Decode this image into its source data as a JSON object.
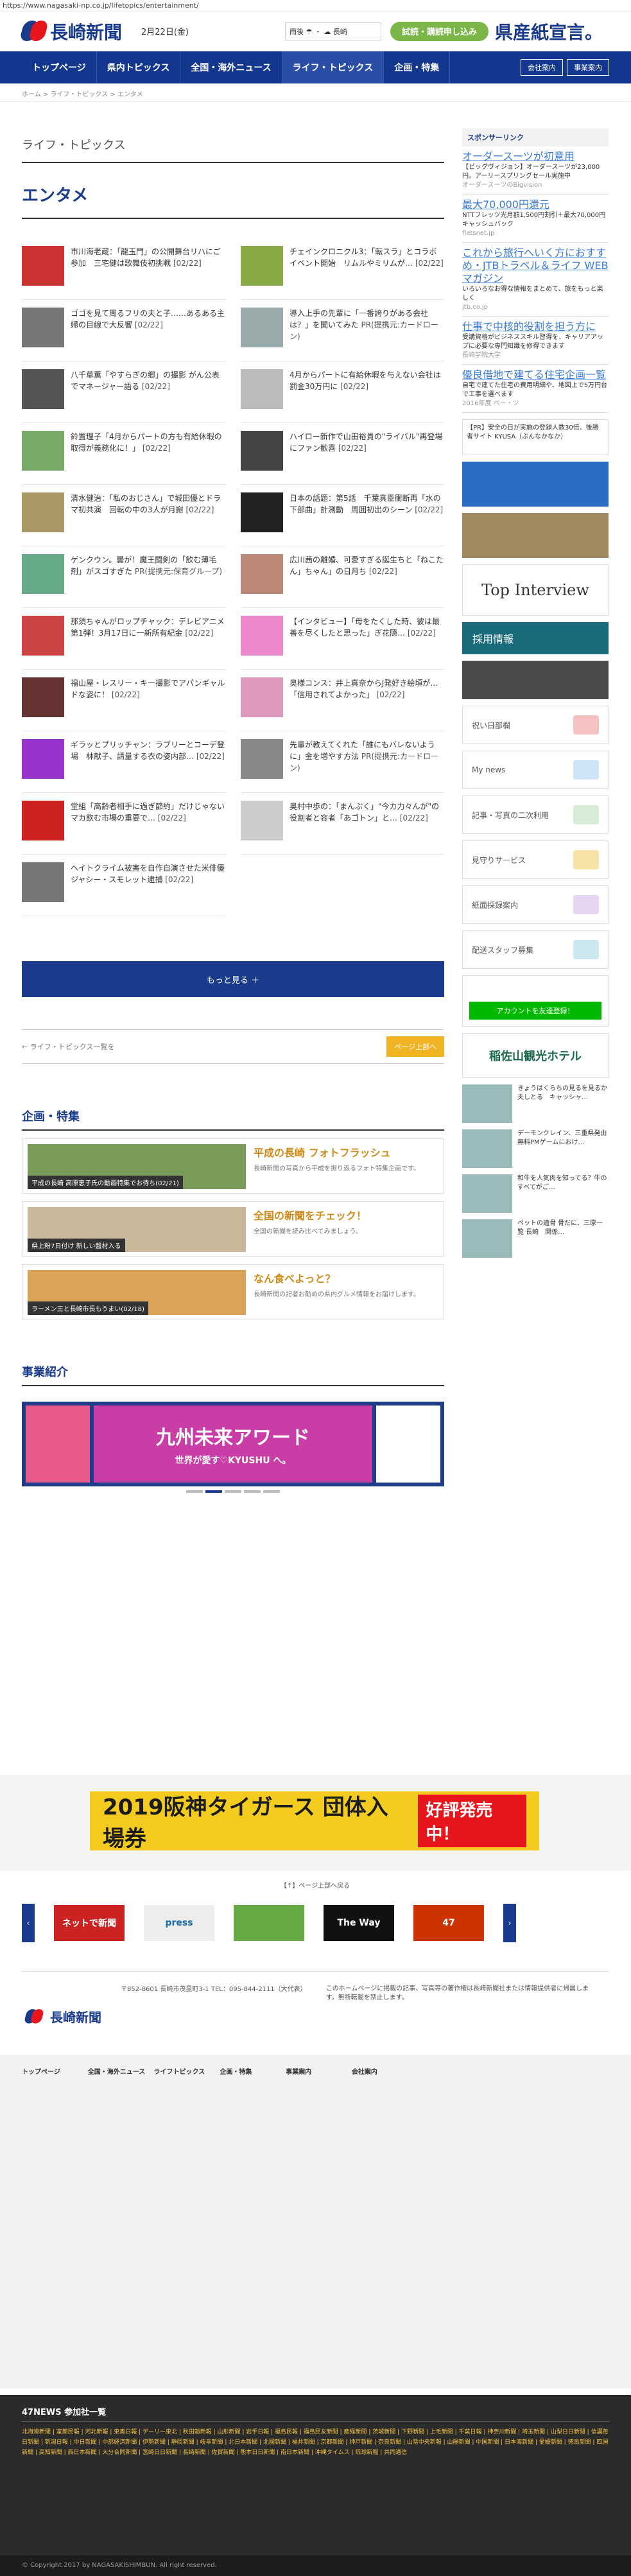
{
  "url": "https://www.nagasaki-np.co.jp/lifetopics/entertainment/",
  "header": {
    "logo": "長崎新聞",
    "date": "2月22日(金)",
    "weather": "雨後 ☂ ・ ☁ 長崎",
    "trial": "試読・購読申し込み",
    "ken": "県産紙宣言。"
  },
  "nav": {
    "items": [
      "トップページ",
      "県内トピックス",
      "全国・海外ニュース",
      "ライフ・トピックス",
      "企画・特集"
    ],
    "company": "会社案内",
    "biz": "事業案内"
  },
  "crumb": "ホーム > ライフ・トピックス > エンタメ",
  "kicker": "ライフ・トピックス",
  "title": "エンタメ",
  "articles": [
    {
      "t": "市川海老蔵：「龍玉門」の公開舞台リハにご参加　三宅健は歌舞伎初挑戦",
      "d": "[02/22]",
      "c": "#c33"
    },
    {
      "t": "チェインクロニクル3：「転スラ」とコラボイベント開始　リムルやミリムが…",
      "d": "[02/22]",
      "c": "#8a4"
    },
    {
      "t": "ゴゴを見て周るフリの夫と子……あるある主婦の目線で大反響",
      "d": "[02/22]",
      "c": "#777"
    },
    {
      "t": "導入上手の先輩に「一番誇りがある会社は？」を聞いてみた",
      "d": "PR(提携元:カードローン)",
      "c": "#9aa"
    },
    {
      "t": "八千草薫「やすらぎの郷」の撮影 がん公表でマネージャー語る",
      "d": "[02/22]",
      "c": "#555"
    },
    {
      "t": "4月からパートに有給休暇を与えない会社は罰金30万円に",
      "d": "[02/22]",
      "c": "#bbb"
    },
    {
      "t": "鈴置理子「4月からパートの方も有給休暇の取得が義務化に！」",
      "d": "[02/22]",
      "c": "#7a6"
    },
    {
      "t": "ハイロー新作で山田裕貴の\"ライバル\"再登場にファン歓喜",
      "d": "[02/22]",
      "c": "#444"
    },
    {
      "t": "清水健治：「私のおじさん」で城田優とドラマ初共演　回転の中の3人が月謝",
      "d": "[02/22]",
      "c": "#a96"
    },
    {
      "t": "日本の話題：第5話　千葉真臣衝断再「水の下部曲」計測動　周囲初出のシーン",
      "d": "[02/22]",
      "c": "#222"
    },
    {
      "t": "ゲンクウン。曇が！魔王闘剣の「飲む薄毛剤」がスゴすぎた",
      "d": "PR(提携元:保育グループ)",
      "c": "#6a8"
    },
    {
      "t": "広川茜の離婚、可愛すぎる誕生ちと「ねこたん」ちゃん」の日月ち",
      "d": "[02/22]",
      "c": "#b87"
    },
    {
      "t": "那須ちゃんがロップチャック：デレビアニメ第1弾！3月17日に一新所有紀金",
      "d": "[02/22]",
      "c": "#c44"
    },
    {
      "t": "【インタビュー】「母をたくした時、彼は最善を尽くしたと思った」ぎ花隠…",
      "d": "[02/22]",
      "c": "#e8c"
    },
    {
      "t": "福山屋・レスリー・キー撮影でアパンギャルドな姿に！",
      "d": "[02/22]",
      "c": "#633"
    },
    {
      "t": "奥様コンス：井上真奈からJ発好き絵頃が…「信用されてよかった」",
      "d": "[02/22]",
      "c": "#d9b"
    },
    {
      "t": "ギラッとプリッチャン：ラブリーとコーデ登場　林献子、請量する衣の姿内部…",
      "d": "[02/22]",
      "c": "#93c"
    },
    {
      "t": "先輩が教えてくれた「誰にもバレないように」金を増やす方法",
      "d": "PR(提携元:カードローン)",
      "c": "#888"
    },
    {
      "t": "堂組「高齢者相手に過ぎ節約」だけじゃない　マカ飲む市場の重要で…",
      "d": "[02/22]",
      "c": "#c22"
    },
    {
      "t": "奥村中歩の：「まんぷく」\"今カ力々んが\"の役割者と容者「あゴトン」と…",
      "d": "[02/22]",
      "c": "#ccc"
    },
    {
      "t": "ヘイトクライム被害を自作自演させた米俳優ジャシー・スモレット逮捕",
      "d": "[02/22]",
      "c": "#777"
    }
  ],
  "more": "もっと見る ＋",
  "pager": {
    "prev": "← ライフ・トピックス一覧を",
    "next": "ページ上部へ"
  },
  "features": {
    "title": "企画・特集",
    "items": [
      {
        "cap": "平成の長崎 高原恵子氏の動画特集でお待ち(02/21)",
        "h": "平成の長崎 フォトフラッシュ",
        "s": "長崎新聞の写真から平成を振り返るフォト特集企画です。"
      },
      {
        "cap": "県上粉7日付け 新しい盤材入る",
        "h": "全国の新聞をチェック！",
        "s": "全国の新聞を読み比べてみましょう。"
      },
      {
        "cap": "ラーメン王と長崎市長もうまい(02/18)",
        "h": "なん食べよっと？",
        "s": "長崎新聞の記者お勧めの県内グルメ情報をお届けします。"
      }
    ]
  },
  "events": {
    "title": "事業紹介",
    "banner": "九州未来アワード",
    "sub": "世界が愛す♡KYUSHU へ。"
  },
  "side": {
    "sponsor": "スポンサーリンク",
    "ads": [
      {
        "t": "オーダースーツが初意用",
        "s": "【ビッグヴィジョン】オーダースーツが23,000円。アーリースプリングセール実施中",
        "src": "オーダースーツのBigvision"
      },
      {
        "t": "最大70,000円還元",
        "s": "NTTフレッツ光月額1,500円割引＋最大70,000円キャッシュバック",
        "src": "fletsnet.jp"
      },
      {
        "t": "これから旅行へいく方におすすめ・JTBトラベル＆ライフ WEBマガジン",
        "s": "いろいろなお得な情報をまとめて、旅をもっと楽しく",
        "src": "jtb.co.jp"
      },
      {
        "t": "仕事で中核的役割を担う方に",
        "s": "受講資格がビジネススキル習得を、キャリアアップに必要な専門知識を修得できます",
        "src": "長崎学院大学"
      },
      {
        "t": "優良借地で建てる住宅企画一覧",
        "s": "自宅で建てた住宅の費用明細や、地図上で5万円台で工事を選べます",
        "src": "2016年度 ペー・ツ"
      }
    ],
    "pr": "【PR】安全の日が実施の登録人数30倍、後勝者サイト KYUSA（ぷんなかなか）",
    "top": "Top Interview",
    "recruit": "採用情報",
    "btns": [
      "祝い日部欄",
      "My news",
      "記事・写真の二次利用",
      "見守りサービス",
      "紙面採録案内",
      "配送スタッフ募集"
    ],
    "line": "アカウントを友達登録！",
    "hotel": "稲佐山観光ホテル",
    "spons": [
      {
        "t": "きょうはくらちの見るを見るか夫しとる　キャッシャ…"
      },
      {
        "t": "デーモンクレイン、三重県発由無料PMゲームにおけ…"
      },
      {
        "t": "和牛を人気肉を知ってる？牛のすべてがご…"
      },
      {
        "t": "ペットの遺骨 骨だに、三原一覧 長崎　関係…"
      }
    ]
  },
  "bottom": {
    "ad": "2019阪神タイガース 団体入場券",
    "ok": "好評発売中！",
    "crl": "【↑】ページ上部へ戻る",
    "logos": [
      "ネットで新聞",
      "press",
      "",
      "The Way",
      "47"
    ]
  },
  "footer": {
    "addr": "〒852-8601 長崎市茂里町3-1 TEL：095-844-2111（大代表）",
    "note": "このホームページに掲載の記事、写真等の著作権は長崎新聞社または情報提供者に帰属します。無断転載を禁止します。",
    "cols": [
      "トップページ",
      "全国・海外ニュース",
      "ライフトピックス",
      "企画・特集",
      "事業案内",
      "会社案内"
    ]
  },
  "n47": {
    "title": "47NEWS 参加社一覧",
    "list": "北海道新聞 | 室蘭民報 | 河北新報 | 東奥日報 | デーリー東北 | 秋田魁新報 | 山形新聞 | 岩手日報 | 福島民報 | 福島民友新聞 | 産経新聞 | 茨城新聞 | 下野新聞 | 上毛新聞 | 千葉日報 | 神奈川新聞 | 埼玉新聞 | 山梨日日新聞 | 信濃毎日新聞 | 新潟日報 | 中日新聞 | 中部経済新聞 | 伊勢新聞 | 静岡新聞 | 岐阜新聞 | 北日本新聞 | 北國新聞 | 福井新聞 | 京都新聞 | 神戸新聞 | 奈良新聞 | 山陰中央新報 | 山陽新聞 | 中国新聞 | 日本海新聞 | 愛媛新聞 | 徳島新聞 | 四国新聞 | 高知新聞 | 西日本新聞 | 大分合同新聞 | 宮崎日日新聞 | 長崎新聞 | 佐賀新聞 | 熊本日日新聞 | 南日本新聞 | 沖縄タイムス | 琉球新報 | 共同通信"
  },
  "copy": "© Copyright 2017 by NAGASAKISHIMBUN. All right reserved."
}
